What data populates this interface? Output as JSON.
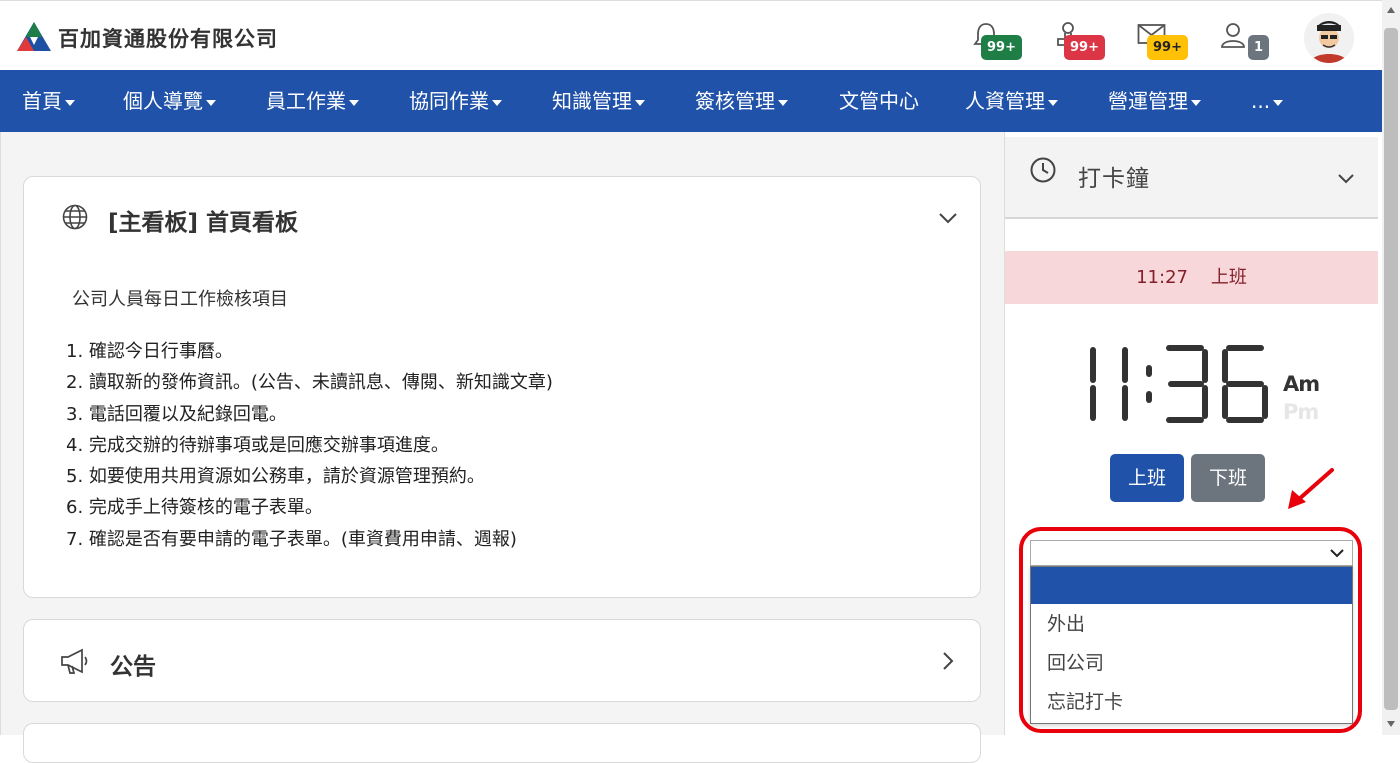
{
  "header": {
    "company_name": "百加資通股份有限公司",
    "badges": {
      "notifications": "99+",
      "approvals": "99+",
      "messages": "99+",
      "users": "1"
    },
    "badge_colors": {
      "notifications": "#1e7e45",
      "approvals": "#dc3545",
      "messages": "#ffc107",
      "users": "#6c757d"
    },
    "icons": [
      "bell-icon",
      "stamp-icon",
      "mail-icon",
      "user-icon",
      "avatar"
    ]
  },
  "nav": {
    "items": [
      {
        "label": "首頁",
        "dropdown": true
      },
      {
        "label": "個人導覽",
        "dropdown": true
      },
      {
        "label": "員工作業",
        "dropdown": true
      },
      {
        "label": "協同作業",
        "dropdown": true
      },
      {
        "label": "知識管理",
        "dropdown": true
      },
      {
        "label": "簽核管理",
        "dropdown": true
      },
      {
        "label": "文管中心",
        "dropdown": false
      },
      {
        "label": "人資管理",
        "dropdown": true
      },
      {
        "label": "營運管理",
        "dropdown": true
      },
      {
        "label": "...",
        "dropdown": true
      }
    ],
    "color": "#1f52a8"
  },
  "main_board": {
    "title": "[主看板] 首頁看板",
    "intro": "公司人員每日工作檢核項目",
    "items": [
      "1. 確認今日行事曆。",
      "2. 讀取新的發佈資訊。(公告、未讀訊息、傳閱、新知識文章)",
      "3. 電話回覆以及紀錄回電。",
      "4. 完成交辦的待辦事項或是回應交辦事項進度。",
      "5. 如要使用共用資源如公務車，請於資源管理預約。",
      "6. 完成手上待簽核的電子表單。",
      "7. 確認是否有要申請的電子表單。(車資費用申請、週報)"
    ]
  },
  "announcement": {
    "title": "公告"
  },
  "punch_clock": {
    "title": "打卡鐘",
    "last_punch_time": "11:27",
    "last_punch_type": "上班",
    "clock_display": "11:36",
    "am_label": "Am",
    "pm_label": "Pm",
    "clock_in_label": "上班",
    "clock_out_label": "下班",
    "select_value": "",
    "options": [
      "",
      "外出",
      "回公司",
      "忘記打卡"
    ]
  }
}
